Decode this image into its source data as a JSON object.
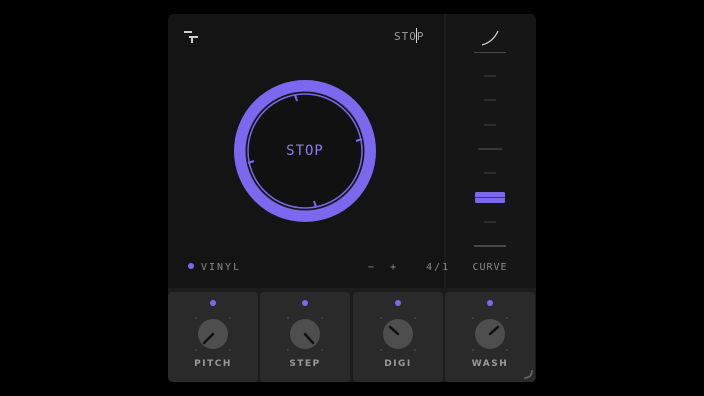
{
  "header": {
    "mode_label": "STOP"
  },
  "dial": {
    "center_label": "STOP",
    "accent_color": "#7b68ee"
  },
  "preset": {
    "name": "VINYL",
    "prev_symbol": "−",
    "next_symbol": "+",
    "counter": "4/1"
  },
  "curve": {
    "label": "CURVE"
  },
  "knobs": [
    {
      "label": "PITCH"
    },
    {
      "label": "STEP"
    },
    {
      "label": "DIGI"
    },
    {
      "label": "WASH"
    }
  ],
  "colors": {
    "accent": "#7b68ee",
    "panel": "#141414",
    "tile": "#2a2a2a"
  }
}
